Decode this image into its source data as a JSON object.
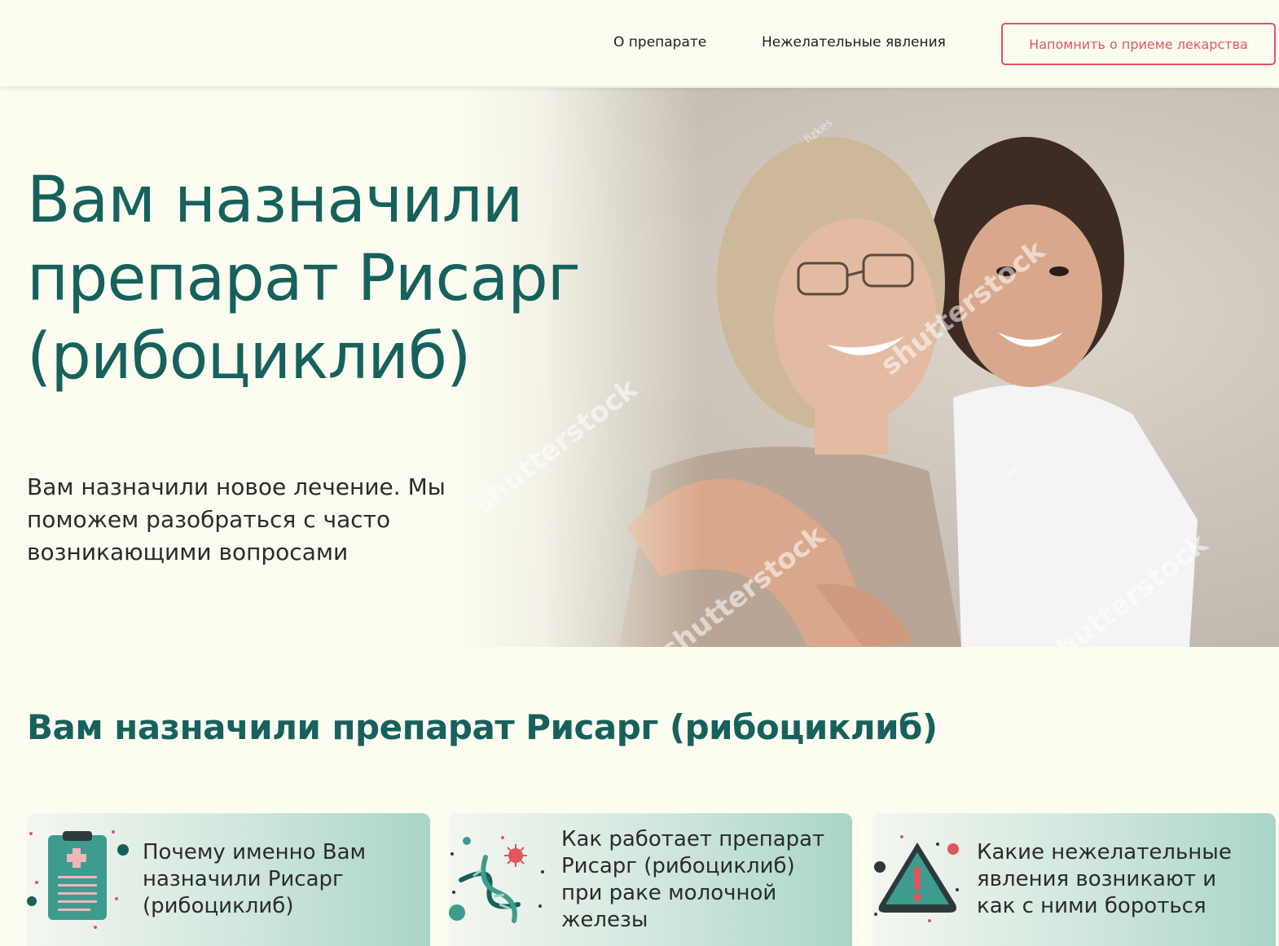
{
  "header": {
    "nav": [
      {
        "label": "О препарате"
      },
      {
        "label": "Нежелательные явления"
      }
    ],
    "cta_label": "Напомнить о приеме лекарства"
  },
  "hero": {
    "title": "Вам назначили препарат Рисарг (рибоциклиб)",
    "subtitle": "Вам назначили новое лечение. Мы поможем разобраться с часто возникающими вопросами",
    "photo_watermark": "shutterstock",
    "photo_credit": "fizkes"
  },
  "section": {
    "title": "Вам назначили препарат Рисарг (рибоциклиб)",
    "cards": [
      {
        "label": "Почему именно Вам назначили Рисарг (рибоциклиб)",
        "icon": "clipboard-icon"
      },
      {
        "label": "Как работает препарат Рисарг (рибоциклиб) при раке молочной железы",
        "icon": "dna-icon"
      },
      {
        "label": "Какие нежелательные явления возникают и как с ними бороться",
        "icon": "warning-icon"
      }
    ]
  },
  "colors": {
    "primary": "#17615c",
    "accent": "#e0565e",
    "background": "#fcfcf1",
    "card_gradient_end": "#a9d5c8"
  }
}
